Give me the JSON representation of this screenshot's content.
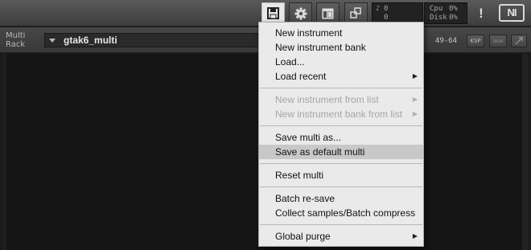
{
  "toolbar": {
    "buttons": [
      {
        "name": "save-icon",
        "active": true
      },
      {
        "name": "gear-icon",
        "active": false
      },
      {
        "name": "layout-icon",
        "active": false
      },
      {
        "name": "resize-icon",
        "active": false
      }
    ],
    "midi_meter": {
      "row1_icon": "note-icon",
      "row1_value": "0",
      "row2_value": "0"
    },
    "cpu_meter": {
      "cpu_label": "Cpu",
      "cpu_value": "0%",
      "disk_label": "Disk",
      "disk_value": "0%"
    },
    "warning_symbol": "!",
    "logo_text": "NI"
  },
  "rack": {
    "label_line1": "Multi",
    "label_line2": "Rack",
    "multi_name": "gtak6_multi",
    "channel_range": "49-64",
    "ksp_label": "KSP",
    "aux_label": "aux"
  },
  "menu": {
    "items": [
      {
        "label": "New instrument",
        "disabled": false,
        "submenu": false
      },
      {
        "label": "New instrument bank",
        "disabled": false,
        "submenu": false
      },
      {
        "label": "Load...",
        "disabled": false,
        "submenu": false
      },
      {
        "label": "Load recent",
        "disabled": false,
        "submenu": true
      },
      {
        "label": "New instrument from list",
        "disabled": true,
        "submenu": true
      },
      {
        "label": "New instrument bank from list",
        "disabled": true,
        "submenu": true
      },
      {
        "label": "Save multi as...",
        "disabled": false,
        "submenu": false
      },
      {
        "label": "Save as default multi",
        "disabled": false,
        "submenu": false,
        "highlighted": true
      },
      {
        "label": "Reset multi",
        "disabled": false,
        "submenu": false
      },
      {
        "label": "Batch re-save",
        "disabled": false,
        "submenu": false
      },
      {
        "label": "Collect samples/Batch compress",
        "disabled": false,
        "submenu": false
      },
      {
        "label": "Global purge",
        "disabled": false,
        "submenu": true
      }
    ],
    "submenu_arrow": "▶"
  },
  "colors": {
    "toolbar_bg": "#4a4a4a",
    "menu_bg": "#eaeaea",
    "menu_highlight": "#c8c8c8",
    "disabled_text": "#a6a6a6"
  }
}
